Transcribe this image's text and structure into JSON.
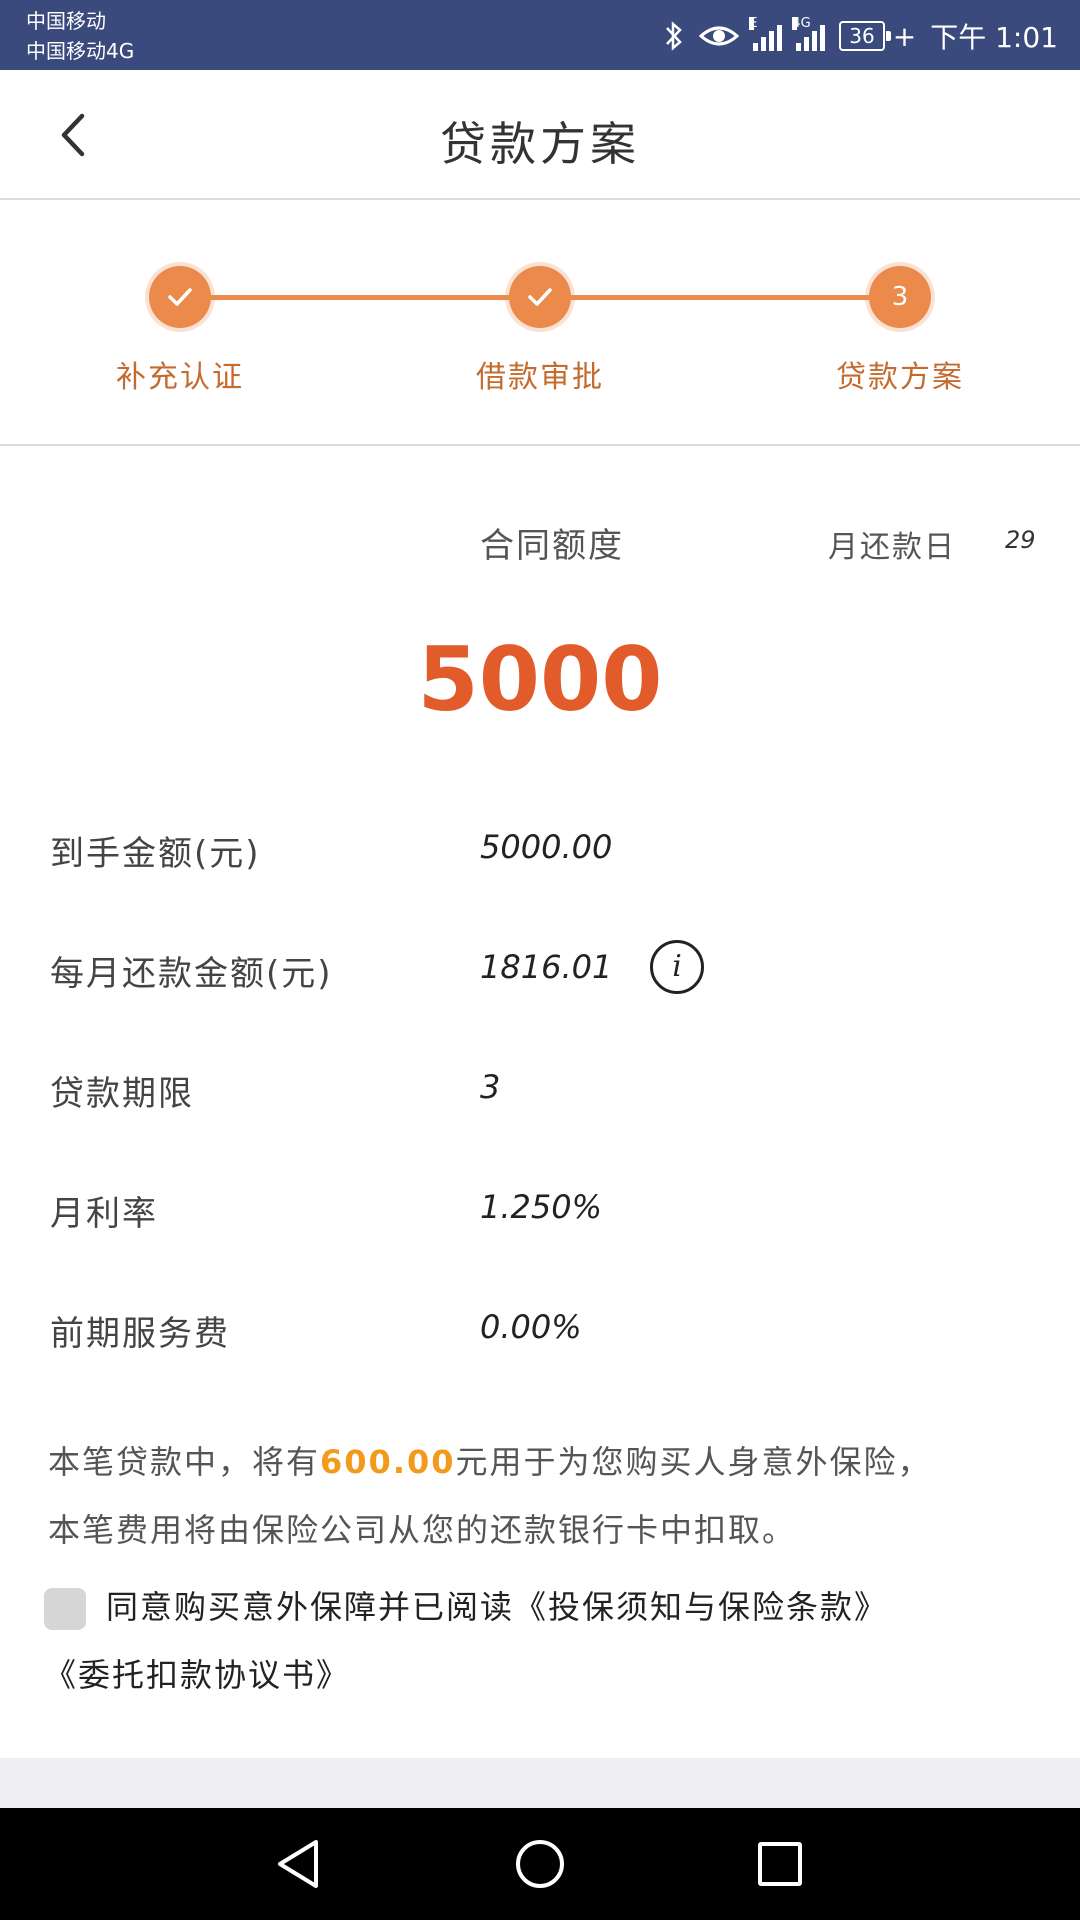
{
  "status_bar": {
    "carrier_1": "中国移动",
    "carrier_2": "中国移动4G",
    "net_1": "E",
    "net_2": "4G",
    "battery": "36",
    "time": "下午 1:01"
  },
  "header": {
    "title": "贷款方案"
  },
  "steps": [
    {
      "label": "补充认证",
      "state": "done"
    },
    {
      "label": "借款审批",
      "state": "done"
    },
    {
      "label": "贷款方案",
      "state": "current",
      "number": "3"
    }
  ],
  "plan": {
    "contract_label": "合同额度",
    "repay_day_label": "月还款日",
    "repay_day_value": "29",
    "contract_amount": "5000",
    "rows": [
      {
        "label": "到手金额(元)",
        "value": "5000.00"
      },
      {
        "label": "每月还款金额(元)",
        "value": "1816.01"
      },
      {
        "label": "贷款期限",
        "value": "3"
      },
      {
        "label": "月利率",
        "value": "1.250%"
      },
      {
        "label": "前期服务费",
        "value": "0.00%"
      }
    ],
    "notice": {
      "part1": "本笔贷款中，将有",
      "highlight": "600.00",
      "part2": "元用于为您购买人身意外保险，",
      "line2": "本笔费用将由保险公司从您的还款银行卡中扣取。"
    },
    "agreement": {
      "line1": "同意购买意外保障并已阅读《投保须知与保险条款》",
      "line2": "《委托扣款协议书》"
    }
  },
  "colors": {
    "status_bar": "#3a4a7c",
    "accent": "#ec8a4b",
    "amount": "#e25b2a",
    "highlight": "#f39a1c"
  },
  "icons": {
    "back": "chevron-left-icon",
    "info": "info-icon",
    "bluetooth": "bluetooth-icon",
    "eye": "eye-icon"
  }
}
